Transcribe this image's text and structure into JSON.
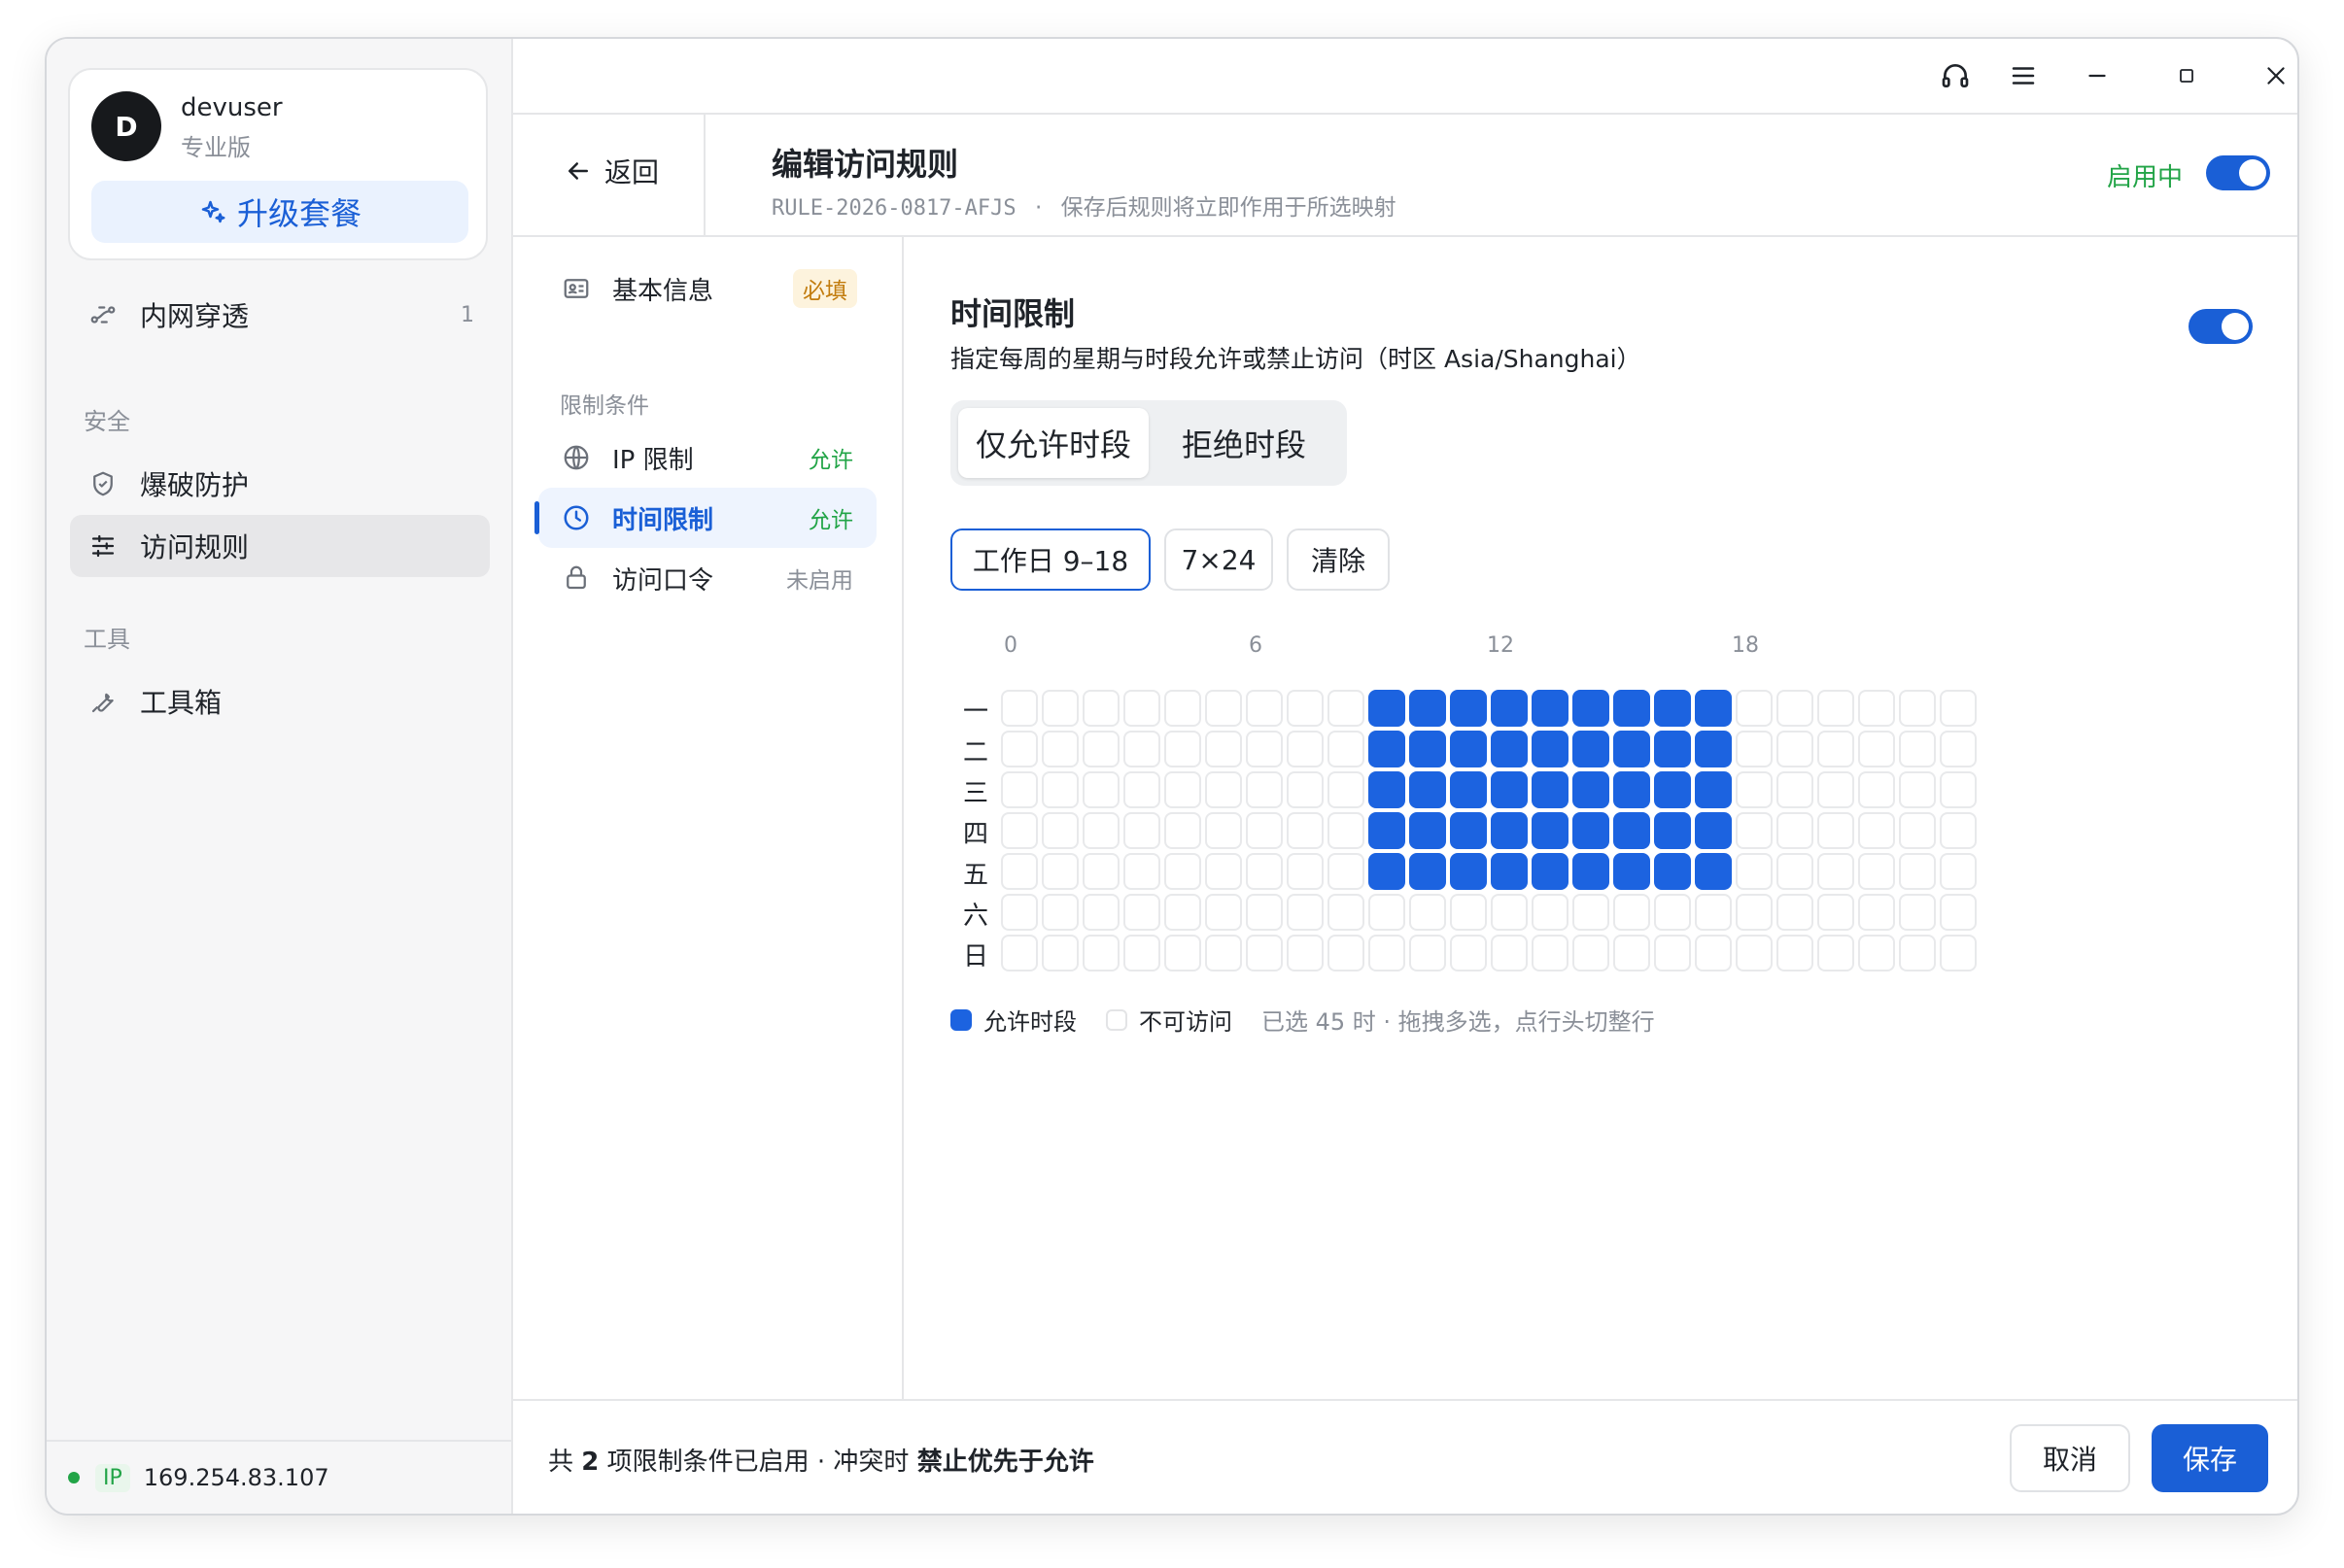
{
  "user": {
    "initial": "D",
    "name": "devuser",
    "plan": "专业版",
    "upgrade_label": "升级套餐"
  },
  "sidebar": {
    "items": [
      {
        "label": "内网穿透",
        "count": "1"
      },
      {
        "section": "安全"
      },
      {
        "label": "爆破防护"
      },
      {
        "label": "访问规则"
      },
      {
        "section": "工具"
      },
      {
        "label": "工具箱"
      }
    ],
    "footer": {
      "ip_tag": "IP",
      "ip": "169.254.83.107"
    }
  },
  "header": {
    "back_label": "返回",
    "title": "编辑访问规则",
    "rule_id": "RULE-2026-0817-AFJS",
    "sub_sep": "·",
    "sub_note": "保存后规则将立即作用于所选映射",
    "status_label": "启用中"
  },
  "secnav": {
    "basic": {
      "label": "基本信息",
      "tag": "必填"
    },
    "group": "限制条件",
    "ip": {
      "label": "IP 限制",
      "tag": "允许"
    },
    "time": {
      "label": "时间限制",
      "tag": "允许"
    },
    "password": {
      "label": "访问口令",
      "tag": "未启用"
    }
  },
  "main": {
    "title": "时间限制",
    "desc": "指定每周的星期与时段允许或禁止访问（时区 Asia/Shanghai）",
    "mode_allow": "仅允许时段",
    "mode_deny": "拒绝时段",
    "preset_workday": "工作日 9–18",
    "preset_all": "7×24",
    "preset_clear": "清除",
    "hour_labels": [
      "0",
      "6",
      "12",
      "18"
    ],
    "days": [
      "一",
      "二",
      "三",
      "四",
      "五",
      "六",
      "日"
    ],
    "schedule": [
      [
        9,
        10,
        11,
        12,
        13,
        14,
        15,
        16,
        17
      ],
      [
        9,
        10,
        11,
        12,
        13,
        14,
        15,
        16,
        17
      ],
      [
        9,
        10,
        11,
        12,
        13,
        14,
        15,
        16,
        17
      ],
      [
        9,
        10,
        11,
        12,
        13,
        14,
        15,
        16,
        17
      ],
      [
        9,
        10,
        11,
        12,
        13,
        14,
        15,
        16,
        17
      ],
      [],
      []
    ],
    "legend_allow": "允许时段",
    "legend_deny": "不可访问",
    "legend_note": "已选 45 时 · 拖拽多选，点行头切整行"
  },
  "footer": {
    "note_prefix": "共",
    "count": "2",
    "note_mid": "项限制条件已启用 · 冲突时",
    "note_bold": "禁止优先于允许",
    "cancel_label": "取消",
    "save_label": "保存"
  },
  "colors": {
    "accent": "#1a5fd6",
    "cell_on": "#1c63e0",
    "success": "#22a447"
  }
}
